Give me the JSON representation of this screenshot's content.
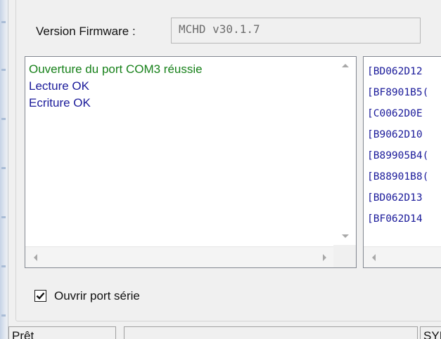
{
  "firmware": {
    "label": "Version Firmware :",
    "value": "MCHD v30.1.7"
  },
  "log_list": {
    "lines": [
      {
        "text": "Ouverture du port COM3 réussie",
        "color": "#17811a"
      },
      {
        "text": "Lecture OK",
        "color": "#1a1a9a"
      },
      {
        "text": "Ecriture OK",
        "color": "#1a1a9a"
      }
    ]
  },
  "hex_list": {
    "lines": [
      "[BD062D12",
      "[BF8901B5(",
      "[C0062D0E",
      "[B9062D10",
      "[B89905B4(",
      "[B88901B8(",
      "[BD062D13",
      "[BF062D14"
    ]
  },
  "serial_checkbox": {
    "label": "Ouvrir port série",
    "checked": true
  },
  "status_bar": {
    "state": "Prêt",
    "middle": "",
    "right": "SYI"
  }
}
